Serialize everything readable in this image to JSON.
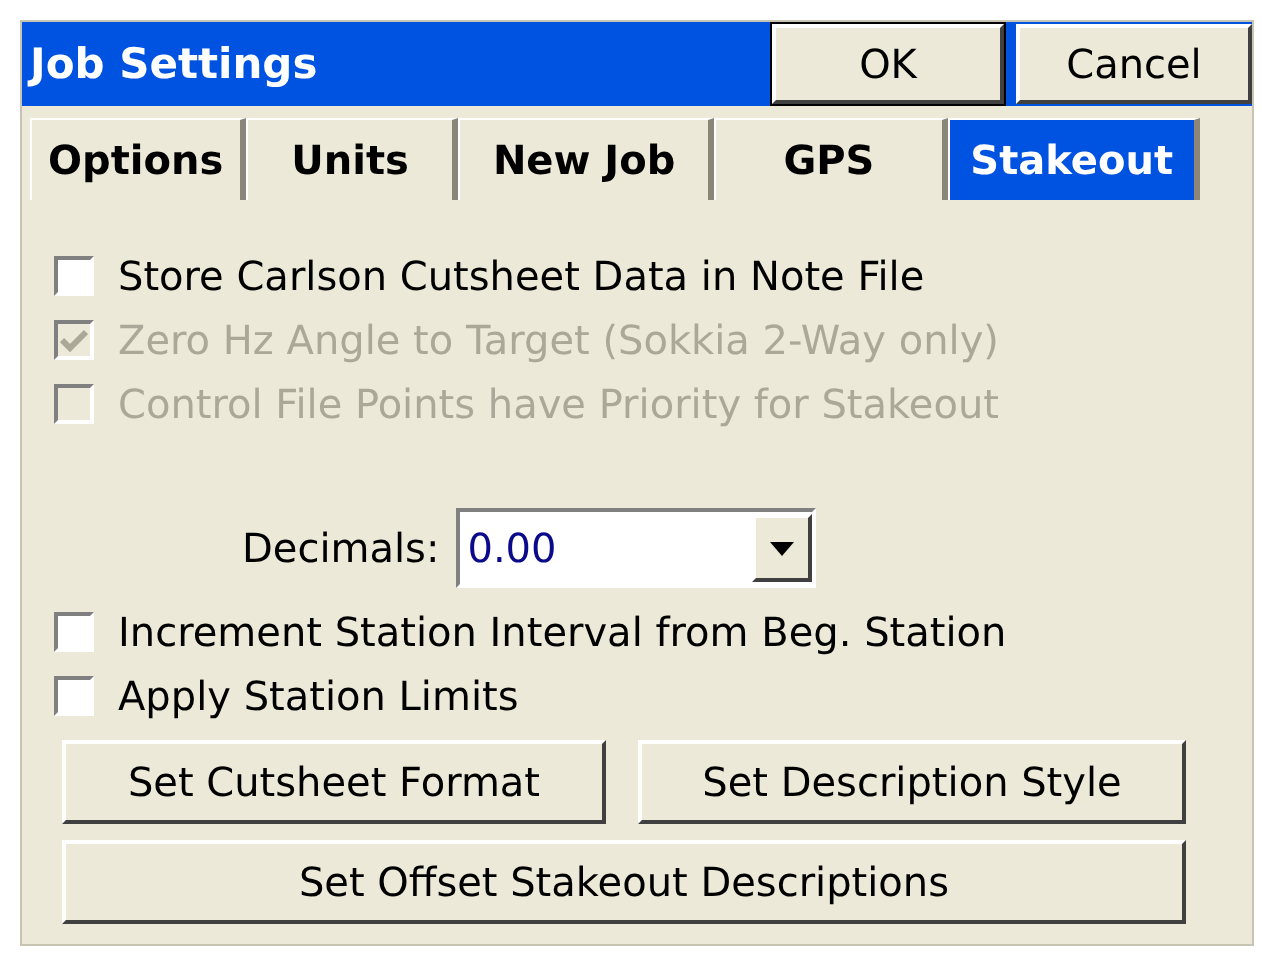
{
  "window": {
    "title": "Job Settings"
  },
  "title_buttons": [
    "OK",
    "Cancel"
  ],
  "tabs": [
    {
      "label": "Options",
      "selected": false
    },
    {
      "label": "Units",
      "selected": false
    },
    {
      "label": "New Job",
      "selected": false
    },
    {
      "label": "GPS",
      "selected": false
    },
    {
      "label": "Stakeout",
      "selected": true
    }
  ],
  "options_top": [
    {
      "label": "Store Carlson Cutsheet Data in Note File",
      "checked": false,
      "disabled": false
    },
    {
      "label": "Zero Hz Angle to Target (Sokkia 2-Way only)",
      "checked": true,
      "disabled": true
    },
    {
      "label": "Control File Points have Priority for Stakeout",
      "checked": false,
      "disabled": true
    }
  ],
  "decimals": {
    "label": "Decimals:",
    "value": "0.00"
  },
  "options_bottom": [
    {
      "label": "Increment Station Interval from Beg. Station",
      "checked": false,
      "disabled": false
    },
    {
      "label": "Apply Station Limits",
      "checked": false,
      "disabled": false
    }
  ],
  "buttons": [
    "Set Cutsheet Format",
    "Set Description Style",
    "Set Offset Stakeout Descriptions"
  ]
}
